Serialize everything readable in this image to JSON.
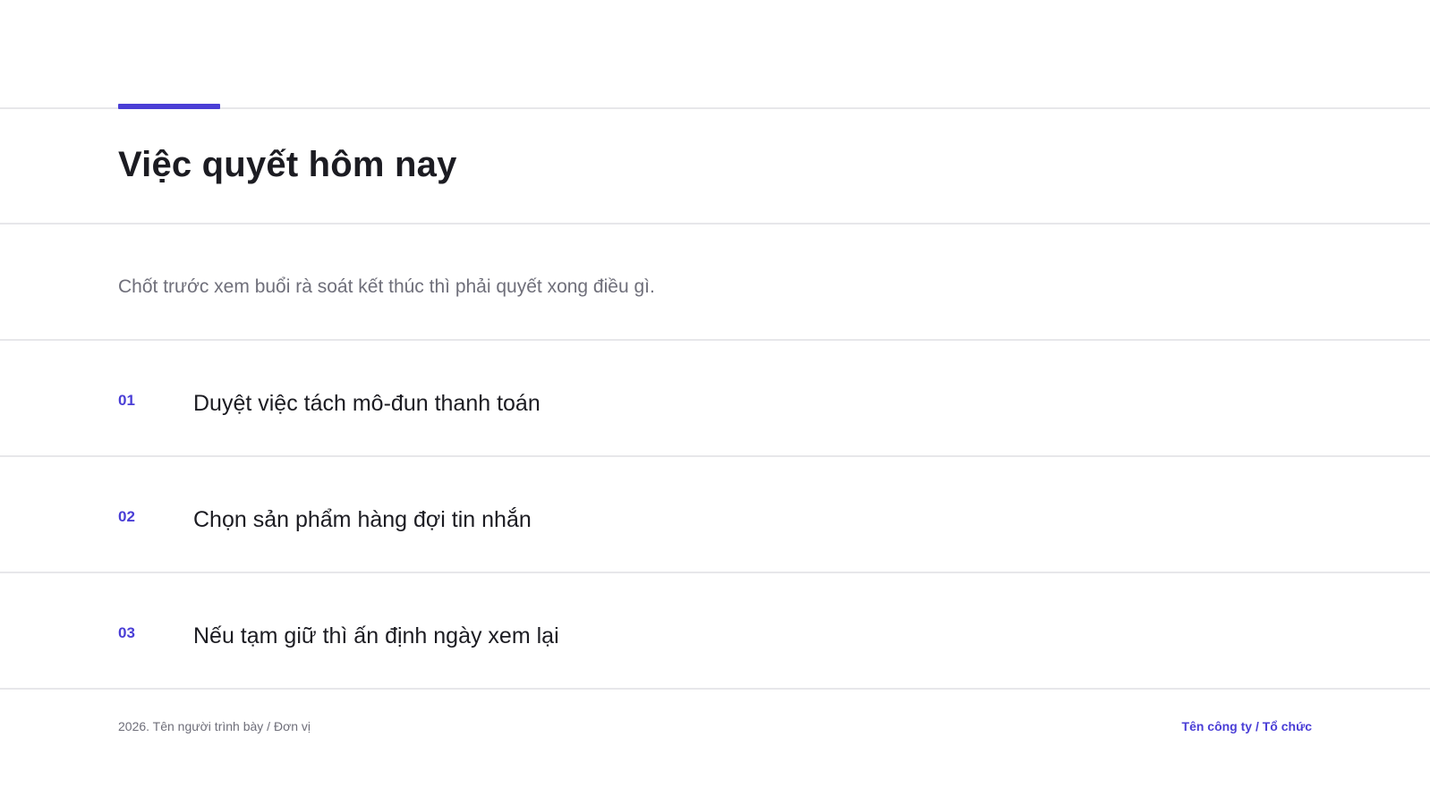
{
  "slide": {
    "title": "Việc quyết hôm nay",
    "subtitle": "Chốt trước xem buổi rà soát kết thúc thì phải quyết xong điều gì.",
    "items": [
      {
        "number": "01",
        "text": "Duyệt việc tách mô-đun thanh toán"
      },
      {
        "number": "02",
        "text": "Chọn sản phẩm hàng đợi tin nhắn"
      },
      {
        "number": "03",
        "text": "Nếu tạm giữ thì ấn định ngày xem lại"
      }
    ],
    "footer": {
      "left": "2026. Tên người trình bày / Đơn vị",
      "right": "Tên công ty / Tổ chức"
    }
  },
  "colors": {
    "accent": "#4a3ed6",
    "title": "#1c1c22",
    "muted": "#6f6f7a",
    "divider": "#e7e7ea",
    "background": "#ffffff"
  }
}
